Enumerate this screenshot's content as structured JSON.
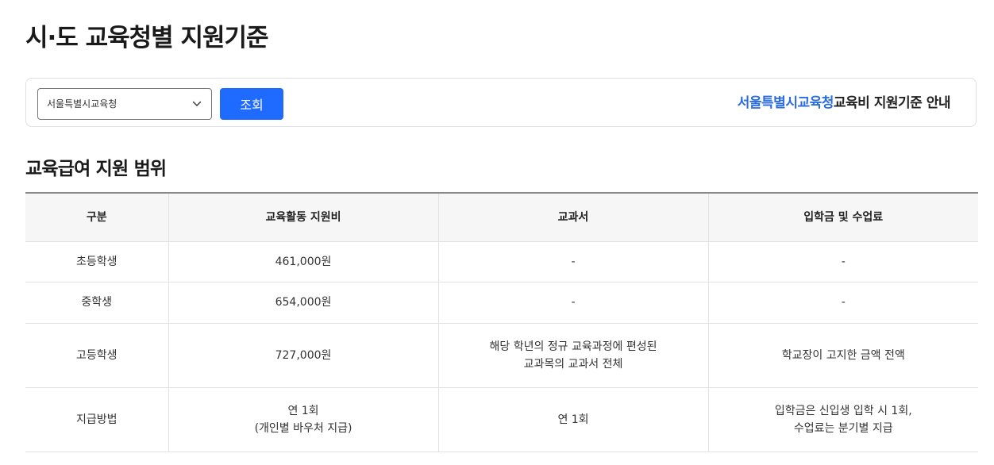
{
  "page": {
    "title": "시·도 교육청별 지원기준"
  },
  "search": {
    "selected_region": "서울특별시교육청",
    "search_button": "조회",
    "guide_highlight": "서울특별시교육청",
    "guide_suffix": "교육비 지원기준 안내"
  },
  "section": {
    "title": "교육급여 지원 범위"
  },
  "table": {
    "headers": [
      "구분",
      "교육활동 지원비",
      "교과서",
      "입학금 및 수업료"
    ],
    "rows": [
      {
        "category": "초등학생",
        "activity": [
          "461,000원"
        ],
        "textbook": [
          "-"
        ],
        "tuition": [
          "-"
        ]
      },
      {
        "category": "중학생",
        "activity": [
          "654,000원"
        ],
        "textbook": [
          "-"
        ],
        "tuition": [
          "-"
        ]
      },
      {
        "category": "고등학생",
        "activity": [
          "727,000원"
        ],
        "textbook": [
          "해당 학년의 정규 교육과정에 편성된",
          "교과목의 교과서 전체"
        ],
        "tuition": [
          "학교장이 고지한 금액 전액"
        ]
      },
      {
        "category": "지급방법",
        "activity": [
          "연 1회",
          "(개인별 바우처 지급)"
        ],
        "textbook": [
          "연 1회"
        ],
        "tuition": [
          "입학금은 신입생 입학 시 1회,",
          "수업료는 분기별 지급"
        ]
      }
    ]
  },
  "icons": {
    "select_chevron": "chevron-down-icon"
  },
  "colors": {
    "primary_button": "#1f6bff",
    "highlight_text": "#2a6de0",
    "table_header_bg": "#f6f6f6"
  }
}
